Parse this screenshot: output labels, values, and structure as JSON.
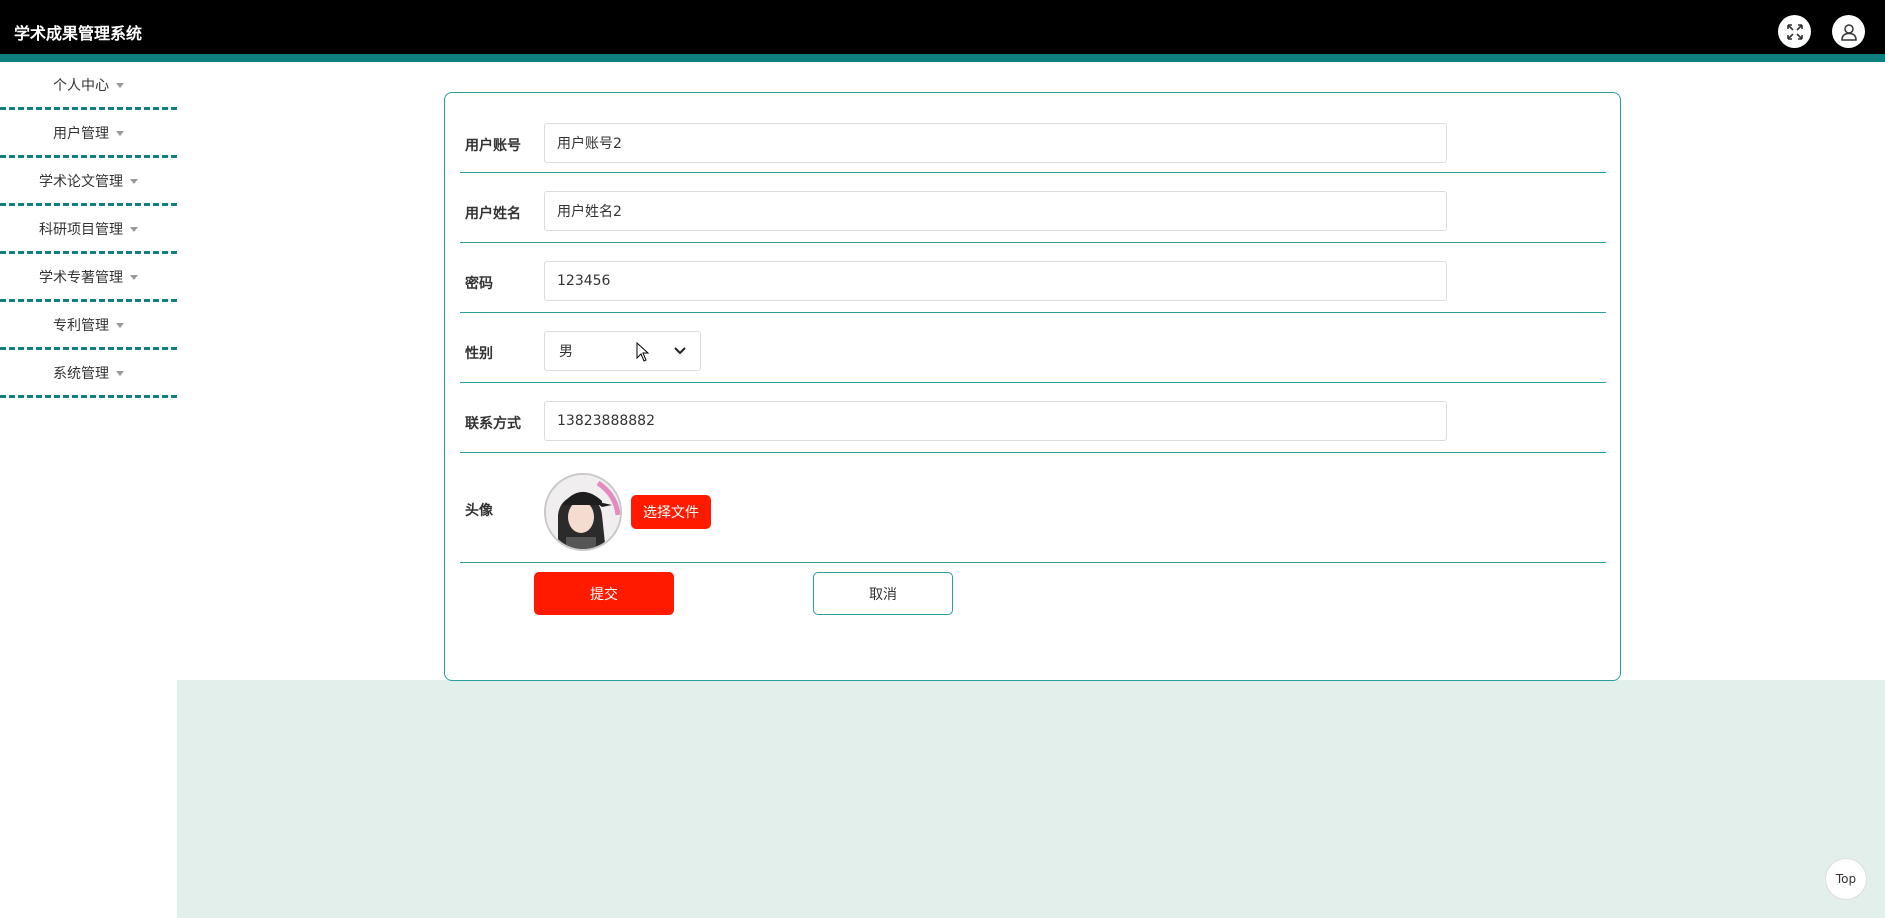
{
  "app": {
    "title": "学术成果管理系统"
  },
  "header": {
    "fullscreen_icon": "expand-icon",
    "user_icon": "user-icon"
  },
  "sidebar": {
    "items": [
      {
        "label": "个人中心"
      },
      {
        "label": "用户管理"
      },
      {
        "label": "学术论文管理"
      },
      {
        "label": "科研项目管理"
      },
      {
        "label": "学术专著管理"
      },
      {
        "label": "专利管理"
      },
      {
        "label": "系统管理"
      }
    ]
  },
  "form": {
    "account": {
      "label": "用户账号",
      "value": "用户账号2"
    },
    "name": {
      "label": "用户姓名",
      "value": "用户姓名2"
    },
    "password": {
      "label": "密码",
      "value": "123456"
    },
    "gender": {
      "label": "性别",
      "selected": "男"
    },
    "phone": {
      "label": "联系方式",
      "value": "13823888882"
    },
    "avatar": {
      "label": "头像",
      "choose_file": "选择文件"
    },
    "submit": "提交",
    "cancel": "取消"
  },
  "back_to_top": "Top",
  "colors": {
    "header_bg": "#000000",
    "accent": "#0f8080",
    "primary_button": "#ff1a00",
    "content_bg": "#e3efea"
  }
}
